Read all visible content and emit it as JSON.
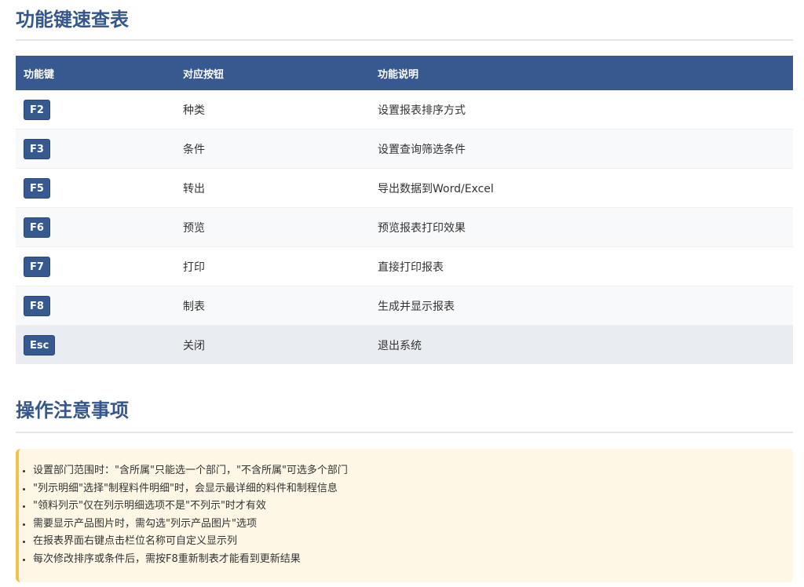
{
  "section1": {
    "title": "功能键速查表"
  },
  "table": {
    "headers": [
      "功能键",
      "对应按钮",
      "功能说明"
    ],
    "rows": [
      {
        "key": "F2",
        "button": "种类",
        "desc": "设置报表排序方式"
      },
      {
        "key": "F3",
        "button": "条件",
        "desc": "设置查询筛选条件"
      },
      {
        "key": "F5",
        "button": "转出",
        "desc": "导出数据到Word/Excel"
      },
      {
        "key": "F6",
        "button": "预览",
        "desc": "预览报表打印效果"
      },
      {
        "key": "F7",
        "button": "打印",
        "desc": "直接打印报表"
      },
      {
        "key": "F8",
        "button": "制表",
        "desc": "生成并显示报表"
      },
      {
        "key": "Esc",
        "button": "关闭",
        "desc": "退出系统"
      }
    ]
  },
  "section2": {
    "title": "操作注意事项"
  },
  "notes": [
    "设置部门范围时：\"含所属\"只能选一个部门，\"不含所属\"可选多个部门",
    "\"列示明细\"选择\"制程料件明细\"时，会显示最详细的料件和制程信息",
    "\"领料列示\"仅在列示明细选项不是\"不列示\"时才有效",
    "需要显示产品图片时，需勾选\"列示产品图片\"选项",
    "在报表界面右键点击栏位名称可自定义显示列",
    "每次修改排序或条件后，需按F8重新制表才能看到更新结果"
  ],
  "colors": {
    "title": "#34568b",
    "header_bg": "#37598f",
    "key_badge": "#36598f",
    "note_bg": "#fef7e6",
    "note_border": "#f1c14b"
  }
}
